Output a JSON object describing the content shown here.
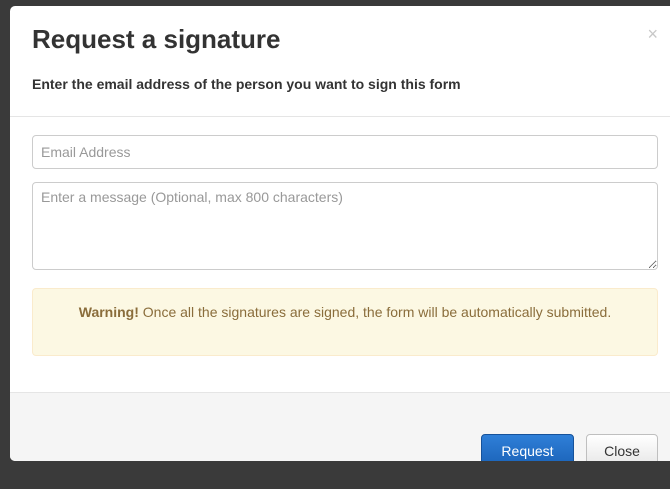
{
  "modal": {
    "title": "Request a signature",
    "subtitle": "Enter the email address of the person you want to sign this form",
    "close_glyph": "×"
  },
  "form": {
    "email_placeholder": "Email Address",
    "message_placeholder": "Enter a message (Optional, max 800 characters)"
  },
  "warning": {
    "label": "Warning!",
    "text": " Once all the signatures are signed, the form will be automatically submitted."
  },
  "footer": {
    "request_label": "Request",
    "close_label": "Close"
  },
  "colors": {
    "primary": "#1a62b8",
    "warning_bg": "#fcf8e3",
    "warning_text": "#8a6d3b"
  },
  "icons": {
    "close": "close-icon"
  }
}
